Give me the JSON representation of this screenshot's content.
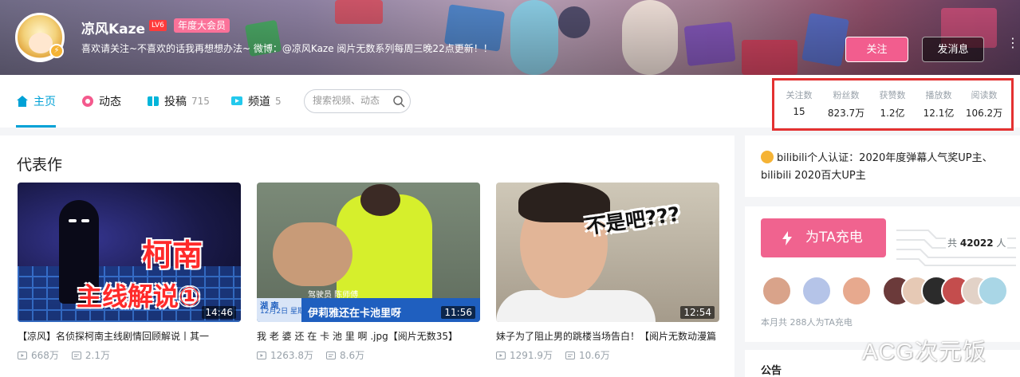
{
  "header": {
    "username": "凉风Kaze",
    "level": "LV6",
    "vip_label": "年度大会员",
    "signature": "喜欢请关注~不喜欢的话我再想想办法~ 微博：@凉风Kaze 阅片无数系列每周三晚22点更新！！",
    "follow_label": "关注",
    "message_label": "发消息",
    "more_label": "⋮"
  },
  "nav": {
    "tabs": [
      {
        "label": "主页",
        "count": "",
        "icon": "home-icon",
        "active": true
      },
      {
        "label": "动态",
        "count": "",
        "icon": "dynamic-icon",
        "active": false
      },
      {
        "label": "投稿",
        "count": "715",
        "icon": "upload-icon",
        "active": false
      },
      {
        "label": "频道",
        "count": "5",
        "icon": "channel-icon",
        "active": false
      }
    ],
    "search_placeholder": "搜索视频、动态"
  },
  "stats": [
    {
      "label": "关注数",
      "value": "15"
    },
    {
      "label": "粉丝数",
      "value": "823.7万"
    },
    {
      "label": "获赞数",
      "value": "1.2亿"
    },
    {
      "label": "播放数",
      "value": "12.1亿"
    },
    {
      "label": "阅读数",
      "value": "106.2万"
    }
  ],
  "main": {
    "section_title": "代表作",
    "videos": [
      {
        "duration": "14:46",
        "title": "【凉风】名侦探柯南主线剧情回顾解说丨其一",
        "plays": "668万",
        "danmaku": "2.1万",
        "cover_text_1": "柯南",
        "cover_text_2": "主线解说①"
      },
      {
        "duration": "11:56",
        "title": "我 老 婆 还 在 卡 池 里 啊 .jpg【阅片无数35】",
        "plays": "1263.8万",
        "danmaku": "8.6万",
        "cover_region": "湖  南",
        "cover_date": "12月2日 星期五",
        "cover_role": "驾驶员 陈师傅",
        "cover_caption": "伊莉雅还在卡池里呀"
      },
      {
        "duration": "12:54",
        "title": "妹子为了阻止男的跳楼当场告白！【阅片无数动漫篇",
        "plays": "1291.9万",
        "danmaku": "10.6万",
        "cover_text": "不是吧???"
      }
    ]
  },
  "sidebar": {
    "certification": "bilibili个人认证：2020年度弹幕人气奖UP主、bilibili  2020百大UP主",
    "charge_label": "为TA充电",
    "total_prefix": "共",
    "total_count": "42022",
    "total_suffix": "人",
    "month_text": "本月共 288人为TA充电",
    "notice_title": "公告",
    "fan_colors": [
      "#d9a38a",
      "#b5c4e8",
      "#e7a98e",
      "#6b3a3a",
      "#e6c9b5",
      "#2b2b2b",
      "#c44d4d",
      "#a9d6e6"
    ]
  },
  "watermark": "ACG次元饭",
  "colors": {
    "accent": "#00a1d6",
    "pink": "#f25d8e",
    "highlight_box": "#e43131"
  }
}
